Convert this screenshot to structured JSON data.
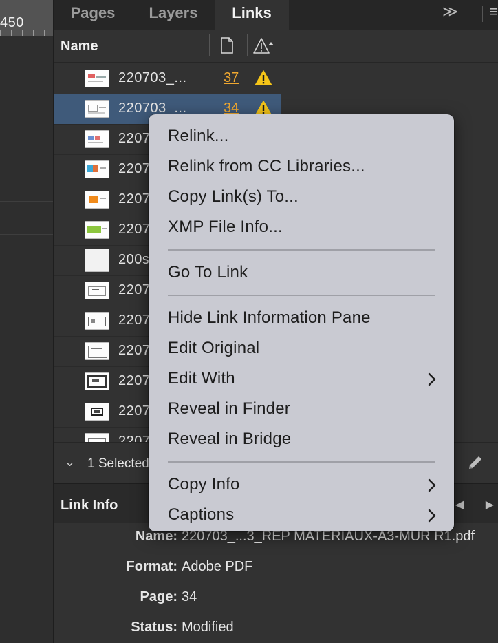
{
  "ruler": {
    "number": "450"
  },
  "tabs": [
    {
      "label": "Pages"
    },
    {
      "label": "Layers"
    },
    {
      "label": "Links"
    }
  ],
  "tabs_menu_icon": "double-chevron-right",
  "header": {
    "name_label": "Name"
  },
  "rows": [
    {
      "name": "220703_...",
      "page": "37",
      "status": "warning"
    },
    {
      "name": "220703_...",
      "page": "34",
      "status": "warning"
    },
    {
      "name": "2207"
    },
    {
      "name": "2207"
    },
    {
      "name": "2207"
    },
    {
      "name": "2207"
    },
    {
      "name": "200s"
    },
    {
      "name": "2207"
    },
    {
      "name": "2207"
    },
    {
      "name": "2207"
    },
    {
      "name": "2207"
    },
    {
      "name": "2207"
    },
    {
      "name": "2207"
    }
  ],
  "footer": {
    "selected_text": "1 Selected"
  },
  "link_info": {
    "title": "Link Info",
    "fields": [
      {
        "label": "Name:",
        "value": "220703_...3_REP MATERIAUX-A3-MUR R1.pdf"
      },
      {
        "label": "Format:",
        "value": "Adobe PDF"
      },
      {
        "label": "Page:",
        "value": "34"
      },
      {
        "label": "Status:",
        "value": "Modified"
      }
    ]
  },
  "context_menu": {
    "items": [
      {
        "label": "Relink..."
      },
      {
        "label": "Relink from CC Libraries..."
      },
      {
        "label": "Copy Link(s) To..."
      },
      {
        "label": "XMP File Info..."
      },
      {
        "label": "Go To Link"
      },
      {
        "label": "Hide Link Information Pane"
      },
      {
        "label": "Edit Original"
      },
      {
        "label": "Edit With",
        "submenu": true
      },
      {
        "label": "Reveal in Finder"
      },
      {
        "label": "Reveal in Bridge"
      },
      {
        "label": "Copy Info",
        "submenu": true
      },
      {
        "label": "Captions",
        "submenu": true
      }
    ]
  },
  "colors": {
    "warning": "#f5c518",
    "page_number": "#f0a830",
    "selection": "#3f5a7a",
    "menu_bg": "#c9cad2"
  }
}
